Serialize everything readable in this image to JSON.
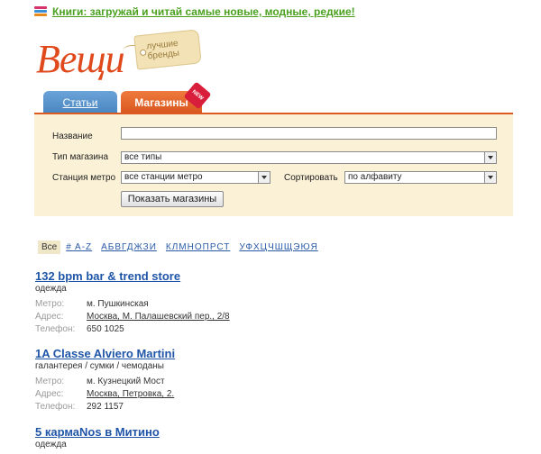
{
  "promo": {
    "text": "Книги: загружай и читай самые новые, модные, редкие!"
  },
  "logo": {
    "wordmark": "Вещи",
    "tag_line1": "лучшие",
    "tag_line2": "бренды"
  },
  "tabs": [
    {
      "label": "Статьи"
    },
    {
      "label": "Магазины"
    }
  ],
  "new_badge": "NEW",
  "form": {
    "name_label": "Название",
    "name_value": "",
    "type_label": "Тип магазина",
    "type_value": "все типы",
    "metro_label": "Станция метро",
    "metro_value": "все станции метро",
    "sort_label": "Сортировать",
    "sort_value": "по алфавиту",
    "submit_label": "Показать магазины"
  },
  "alphabet": {
    "all": "Все",
    "groups": [
      "# A-Z",
      "АБВГДЖЗИ",
      "КЛМНОПРСТ",
      "УФХЦЧШЩЭЮЯ"
    ]
  },
  "field_labels": {
    "metro": "Метро:",
    "address": "Адрес:",
    "phone": "Телефон:"
  },
  "stores": [
    {
      "name": "132 bpm bar & trend store",
      "category": "одежда",
      "metro": "м. Пушкинская",
      "address": "Москва, М. Палашевский пер., 2/8",
      "phone": "650 1025"
    },
    {
      "name": "1A Classe Alviero Martini",
      "category": "галантерея / сумки / чемоданы",
      "metro": "м. Кузнецкий Мост",
      "address": "Москва, Петровка, 2.",
      "phone": "292 1157"
    },
    {
      "name": "5 кармаNоs в Митино",
      "category": "одежда"
    }
  ],
  "colors": {
    "accent": "#dc5a20",
    "link": "#1f55a8",
    "promo": "#4aa11f",
    "panel": "#faf1d6"
  }
}
